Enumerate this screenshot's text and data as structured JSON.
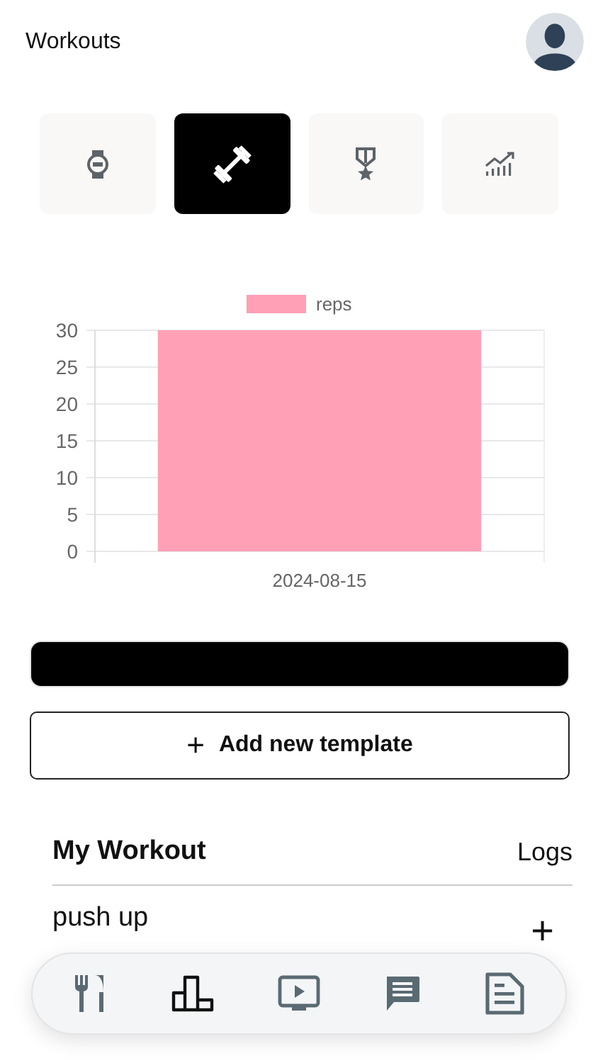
{
  "header": {
    "title": "Workouts"
  },
  "tabs": [
    {
      "kind": "watch",
      "selected": false
    },
    {
      "kind": "dumbbell",
      "selected": true
    },
    {
      "kind": "medal",
      "selected": false
    },
    {
      "kind": "growth",
      "selected": false
    }
  ],
  "chart": {
    "chart_data": {
      "type": "bar",
      "categories": [
        "2024-08-15"
      ],
      "series": [
        {
          "name": "reps",
          "color": "#ffa0b6",
          "values": [
            30
          ]
        }
      ],
      "ylim": [
        0,
        30
      ],
      "grid": true,
      "yticks": [
        0,
        5,
        10,
        15,
        20,
        25,
        30
      ]
    }
  },
  "add_button": {
    "icon": "+",
    "label": "Add new template"
  },
  "my_workout": {
    "title": "My Workout",
    "logs_link": "Logs",
    "items": [
      {
        "name": "push up",
        "action": "+"
      }
    ]
  },
  "bottom_nav": [
    {
      "kind": "food",
      "selected": false
    },
    {
      "kind": "podium",
      "selected": true
    },
    {
      "kind": "video",
      "selected": false
    },
    {
      "kind": "chat",
      "selected": false
    },
    {
      "kind": "document",
      "selected": false
    }
  ]
}
